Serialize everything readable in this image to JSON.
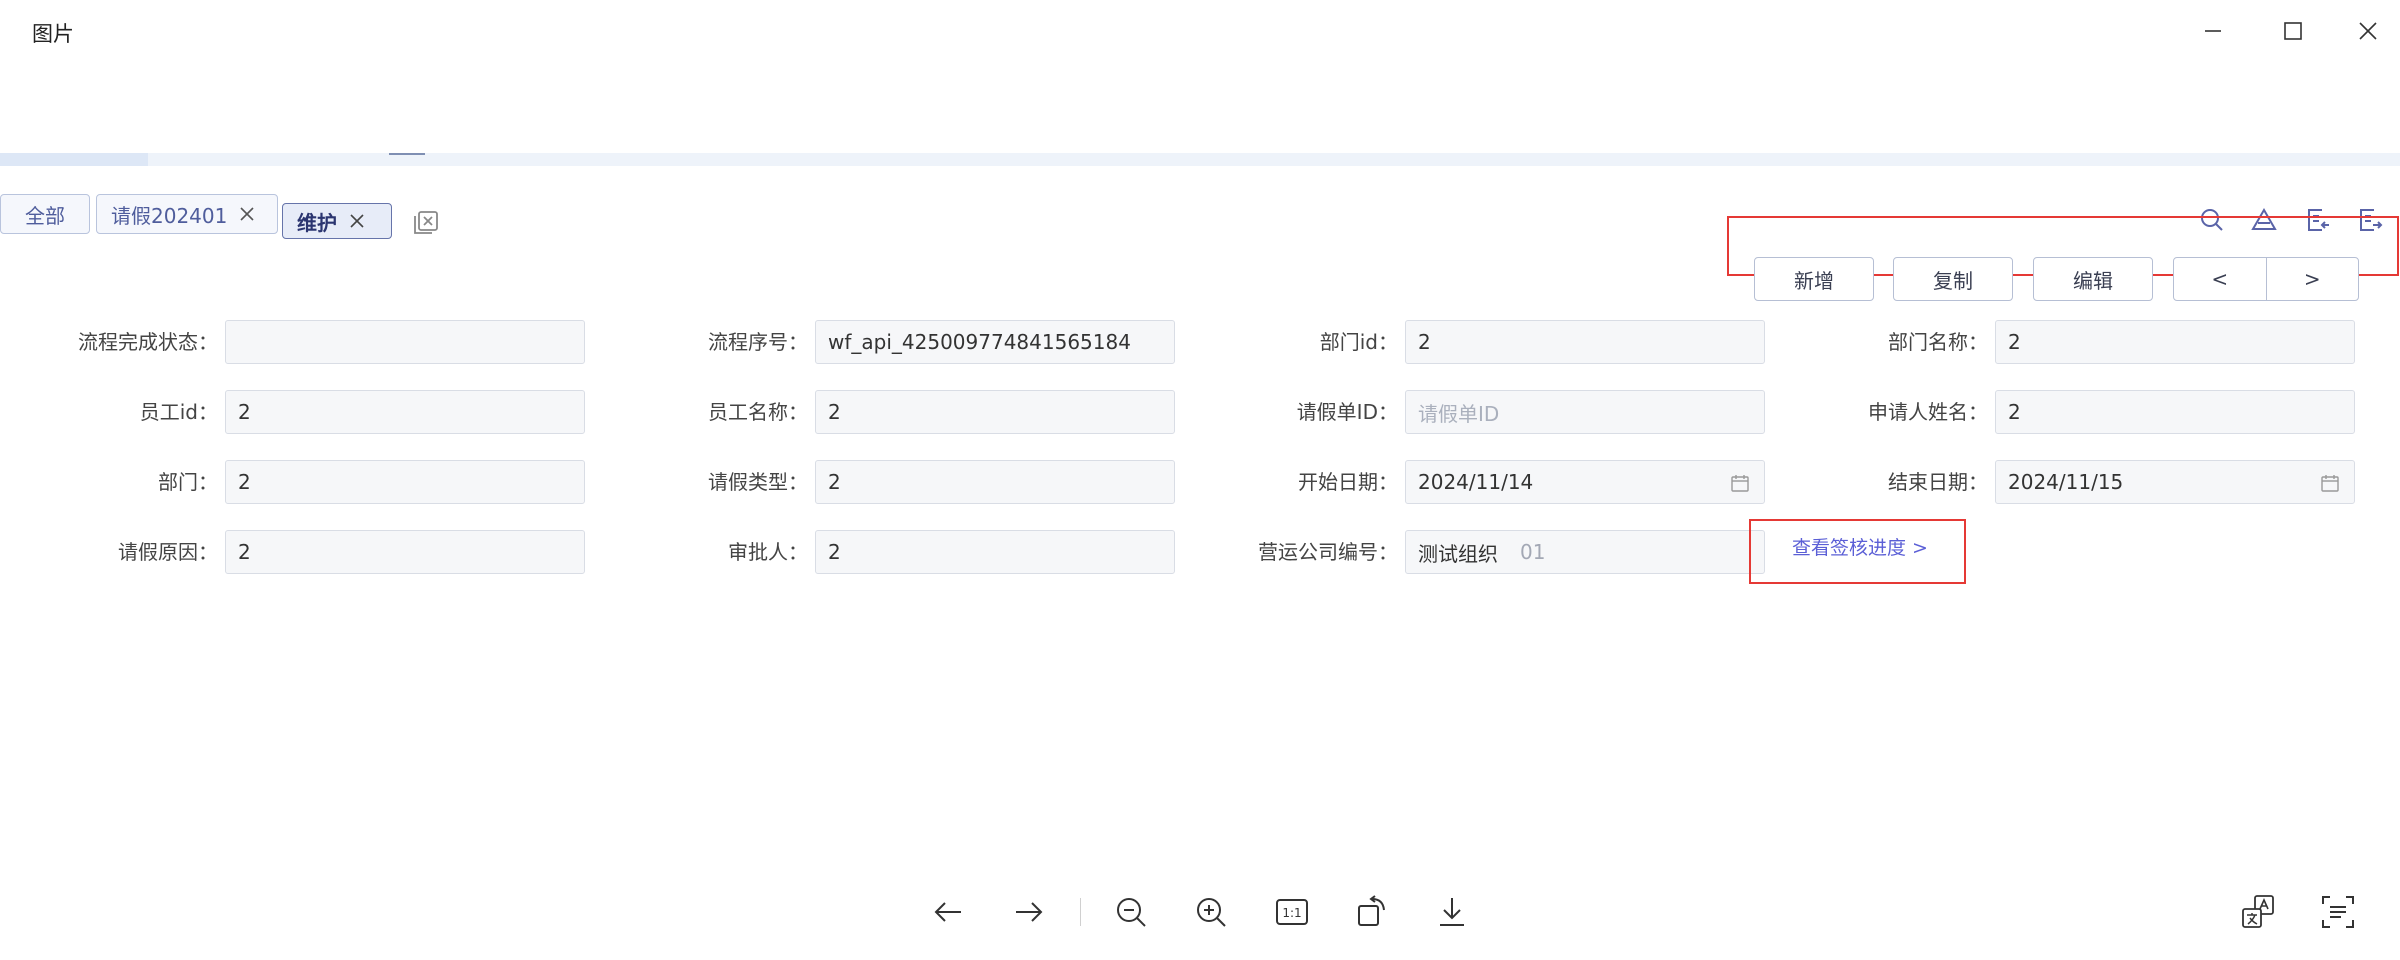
{
  "window": {
    "title": "图片",
    "controls": [
      {
        "name": "minimize-icon"
      },
      {
        "name": "maximize-icon"
      },
      {
        "name": "close-icon"
      }
    ]
  },
  "tabs": {
    "items": [
      {
        "label": "全部",
        "closable": false,
        "active": false
      },
      {
        "label": "请假202401",
        "closable": true,
        "active": false
      },
      {
        "label": "维护",
        "closable": true,
        "active": true
      }
    ],
    "close_all_icon": "close-all-tabs-icon"
  },
  "toolbar_icons": [
    "search-icon",
    "filter-icon",
    "import-icon",
    "export-icon"
  ],
  "actions": {
    "add_label": "新增",
    "copy_label": "复制",
    "edit_label": "编辑",
    "prev_label": "<",
    "next_label": ">",
    "accent": "#e53935"
  },
  "form": {
    "process_status": {
      "label": "流程完成状态：",
      "value": ""
    },
    "process_no": {
      "label": "流程序号：",
      "value": "wf_api_425009774841565184"
    },
    "dept_id": {
      "label": "部门id：",
      "value": "2"
    },
    "dept_name": {
      "label": "部门名称：",
      "value": "2"
    },
    "emp_id": {
      "label": "员工id：",
      "value": "2"
    },
    "emp_name": {
      "label": "员工名称：",
      "value": "2"
    },
    "leave_id": {
      "label": "请假单ID：",
      "value": "",
      "placeholder": "请假单ID"
    },
    "applicant": {
      "label": "申请人姓名：",
      "value": "2"
    },
    "dept": {
      "label": "部门：",
      "value": "2"
    },
    "leave_type": {
      "label": "请假类型：",
      "value": "2"
    },
    "start_date": {
      "label": "开始日期：",
      "value": "2024/11/14"
    },
    "end_date": {
      "label": "结束日期：",
      "value": "2024/11/15"
    },
    "reason": {
      "label": "请假原因：",
      "value": "2"
    },
    "approver": {
      "label": "审批人：",
      "value": "2"
    },
    "company_no": {
      "label": "营运公司编号：",
      "value": "测试组织",
      "code": "01"
    }
  },
  "links": {
    "progress_label": "查看签核进度 >",
    "color": "#5b5fd6"
  },
  "viewer_toolbar": [
    "arrow-left-icon",
    "arrow-right-icon",
    "zoom-out-icon",
    "zoom-in-icon",
    "actual-size-icon",
    "rotate-icon",
    "download-icon",
    "translate-icon",
    "text-scan-icon"
  ],
  "viewer": {
    "actual_size_label": "1:1"
  }
}
